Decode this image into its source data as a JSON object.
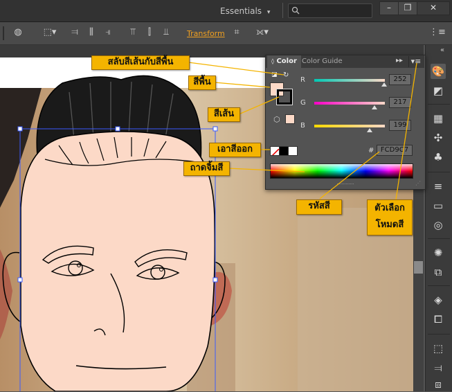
{
  "topbar": {
    "workspace_label": "Essentials",
    "workspace_arrow": "▾",
    "search_placeholder": "",
    "search_icon": "search-icon",
    "window_buttons": [
      "–",
      "❐",
      "✕"
    ]
  },
  "control_bar": {
    "transform_label": "Transform"
  },
  "color_panel": {
    "tabs": [
      "Color",
      "Color Guide"
    ],
    "active_tab": "Color",
    "channels": [
      {
        "label": "R",
        "value": "252",
        "fraction": 0.988,
        "track_from": "#00c8b4",
        "track_to": "#fcd9c7"
      },
      {
        "label": "G",
        "value": "217",
        "fraction": 0.851,
        "track_from": "#fc00c7",
        "track_to": "#fcd9c7"
      },
      {
        "label": "B",
        "value": "199",
        "fraction": 0.78,
        "track_from": "#fcd900",
        "track_to": "#fcd9c7"
      }
    ],
    "hex_symbol": "#",
    "hex_value": "FCD9C7",
    "fill_color": "#fcd9c7",
    "stroke_color": "#000000"
  },
  "callouts": {
    "swap_fill_stroke": "สลับสีเส้นกับสีพื้น",
    "fill": "สีพื้น",
    "stroke": "สีเส้น",
    "none_color": "เอาสีออก",
    "color_spectrum": "ถาดจิ้มสี",
    "hex_code": "รหัสสี",
    "mode_options_line1": "ตัวเลือก",
    "mode_options_line2": "โหมดสี"
  },
  "colors": {
    "accent": "#f4b400",
    "transform_link": "#f0a020",
    "skin": "#fcd9c7",
    "selection": "#3a5bff"
  }
}
